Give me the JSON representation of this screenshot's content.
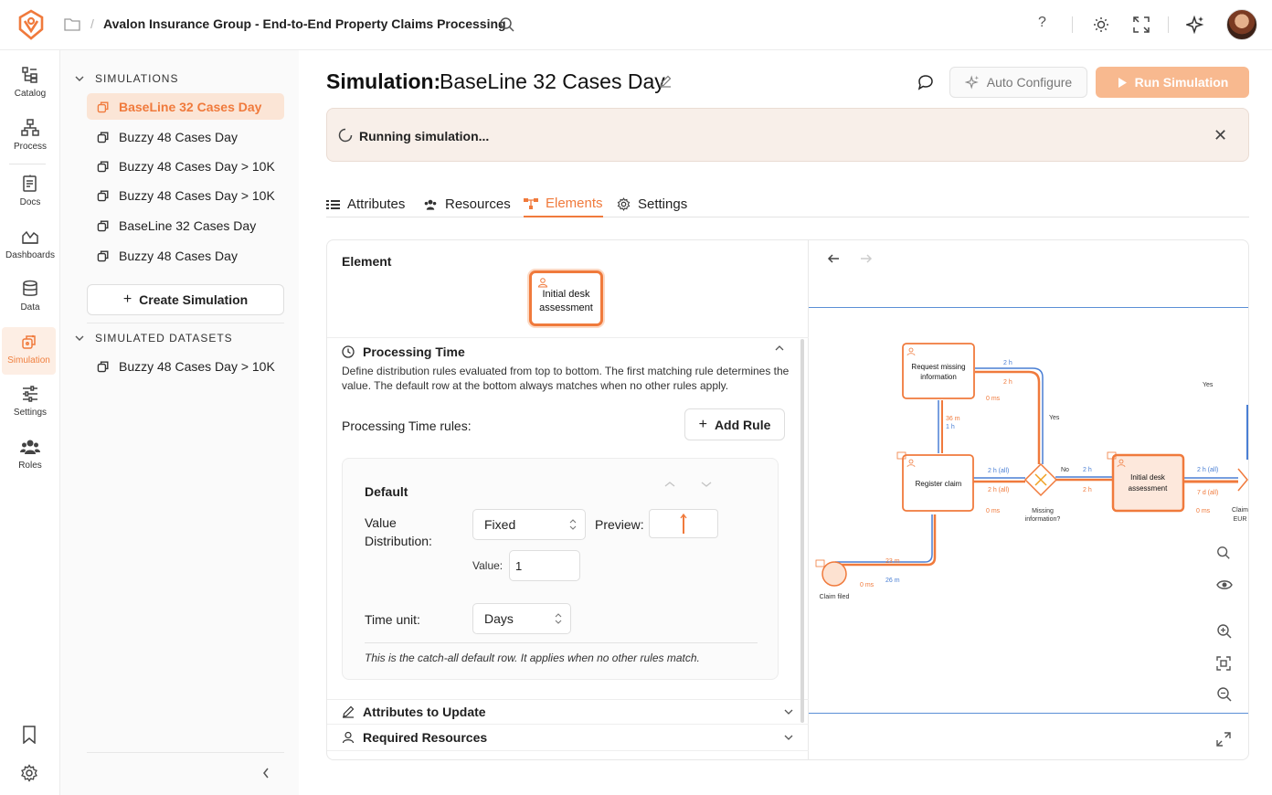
{
  "breadcrumb": {
    "title": "Avalon Insurance Group - End-to-End Property Claims Processing"
  },
  "topbar": {
    "help": "?"
  },
  "rail": {
    "items": [
      {
        "label": "Catalog"
      },
      {
        "label": "Process"
      },
      {
        "label": "Docs"
      },
      {
        "label": "Dashboards"
      },
      {
        "label": "Data"
      },
      {
        "label": "Simulation"
      },
      {
        "label": "Settings"
      },
      {
        "label": "Roles"
      }
    ]
  },
  "sidebar": {
    "simulations_header": "SIMULATIONS",
    "simulations": [
      {
        "label": "BaseLine 32 Cases Day"
      },
      {
        "label": "Buzzy 48 Cases Day"
      },
      {
        "label": "Buzzy 48 Cases Day > 10K"
      },
      {
        "label": "Buzzy 48 Cases Day > 10K"
      },
      {
        "label": "BaseLine 32 Cases Day"
      },
      {
        "label": "Buzzy 48 Cases Day"
      }
    ],
    "create_label": "Create Simulation",
    "datasets_header": "SIMULATED DATASETS",
    "datasets": [
      {
        "label": "Buzzy 48 Cases Day > 10K"
      }
    ]
  },
  "header": {
    "title_prefix": "Simulation:",
    "title_name": "BaseLine 32 Cases Day",
    "auto_configure": "Auto Configure",
    "run": "Run Simulation"
  },
  "banner": {
    "text": "Running simulation...",
    "close": "✕"
  },
  "tabs": [
    {
      "label": "Attributes"
    },
    {
      "label": "Resources"
    },
    {
      "label": "Elements"
    },
    {
      "label": "Settings"
    }
  ],
  "element": {
    "label": "Element",
    "node_line1": "Initial desk",
    "node_line2": "assessment"
  },
  "processing": {
    "title": "Processing Time",
    "description": "Define distribution rules evaluated from top to bottom. The first matching rule determines the value. The default row at the bottom always matches when no other rules apply.",
    "rules_label": "Processing Time rules:",
    "add_rule": "Add Rule",
    "default_label": "Default",
    "value_distribution_label": "Value Distribution:",
    "distribution": "Fixed",
    "preview_label": "Preview:",
    "value_label": "Value:",
    "value": "1",
    "time_unit_label": "Time unit:",
    "time_unit": "Days",
    "catch_all": "This is the catch-all default row. It applies when no other rules match."
  },
  "accordions": [
    {
      "label": "Attributes to Update"
    },
    {
      "label": "Required Resources"
    }
  ],
  "diagram": {
    "nodes": [
      {
        "line1": "Request missing",
        "line2": "information"
      },
      {
        "line1": "Register claim"
      },
      {
        "line1": "Initial desk",
        "line2": "assessment"
      }
    ],
    "gateway_label_1": "Missing",
    "gateway_label_2": "information?",
    "start_label": "Claim filed",
    "right_label_1": "Claim",
    "right_label_2": "EUR",
    "edge_labels": [
      "2 h",
      "2 h",
      "0 ms",
      "36 m",
      "1 h",
      "Yes",
      "Yes",
      "2 h (all)",
      "2 h (all)",
      "0 ms",
      "No",
      "2 h",
      "2 h",
      "2 h (all)",
      "7 d (all)",
      "0 ms",
      "23 m",
      "26 m",
      "0 ms"
    ]
  },
  "colors": {
    "accent": "#f07a3c",
    "accent_light": "#fbe5d6",
    "blue": "#4a7fd4"
  }
}
